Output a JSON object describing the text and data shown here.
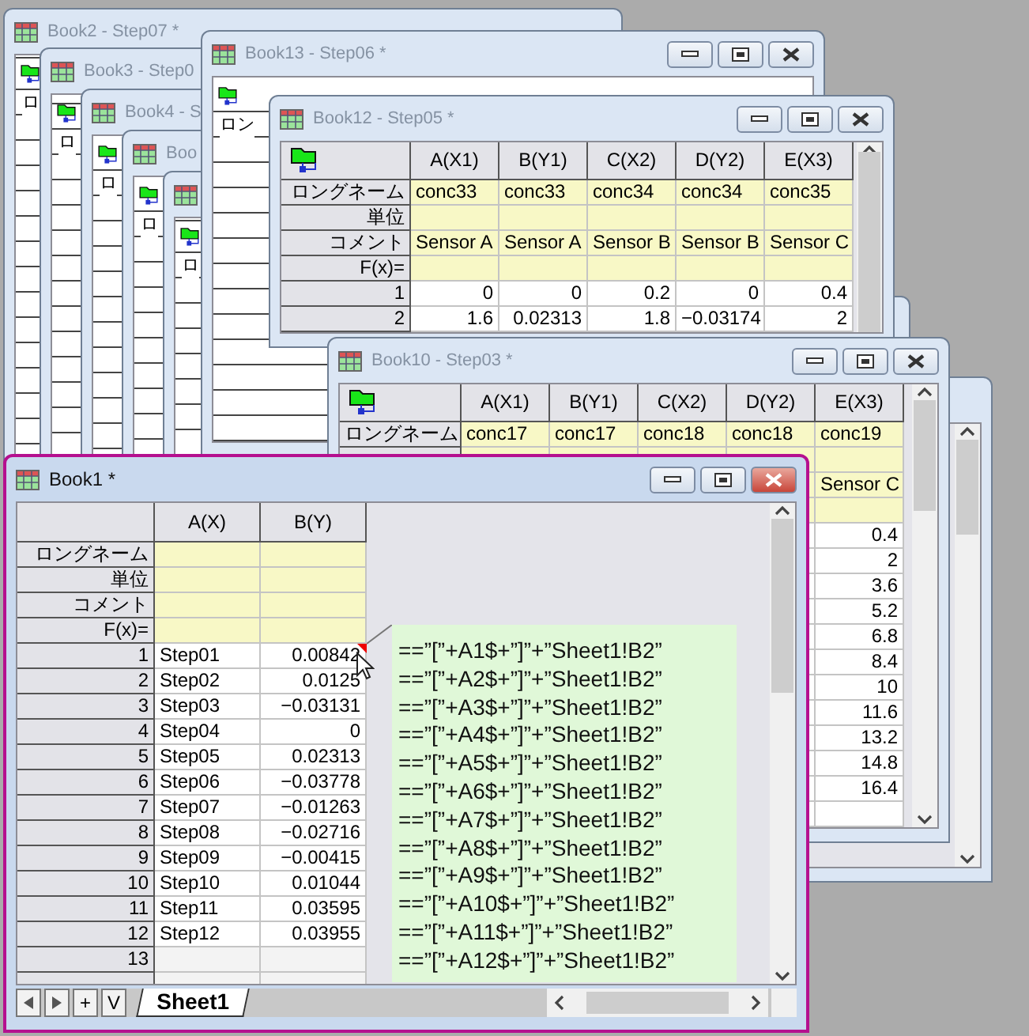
{
  "windows": [
    {
      "kind": "stub",
      "title": "Book2 - Step07 *",
      "row_label": "ロ"
    },
    {
      "kind": "stub",
      "title": "Book3 - Step0",
      "row_label": "ロ"
    },
    {
      "kind": "stub",
      "title": "Book4 - S",
      "row_label": "ロ"
    },
    {
      "kind": "stub",
      "title": "Boo",
      "row_label": "ロ"
    },
    {
      "kind": "stub",
      "row_label": "ロ"
    },
    {
      "kind": "stub",
      "title": "Book13 - Step06 *",
      "row_label": "ロン"
    },
    {
      "kind": "frame"
    },
    {
      "kind": "sheet",
      "title": "Book12 - Step05 *",
      "columns": [
        "A(X1)",
        "B(Y1)",
        "C(X2)",
        "D(Y2)",
        "E(X3)"
      ],
      "meta_rows": [
        {
          "label": "ロングネーム",
          "values": [
            "conc33",
            "conc33",
            "conc34",
            "conc34",
            "conc35"
          ]
        },
        {
          "label": "単位"
        },
        {
          "label": "コメント",
          "values": [
            "Sensor A",
            "Sensor A",
            "Sensor B",
            "Sensor B",
            "Sensor C"
          ]
        },
        {
          "label": "F(x)="
        }
      ],
      "rows": [
        {
          "index": "1",
          "cells": [
            "0",
            "0",
            "0.2",
            "0",
            "0.4"
          ]
        },
        {
          "index": "2",
          "cells": [
            "1.6",
            "0.02313",
            "1.8",
            "−0.03174",
            "2"
          ]
        }
      ]
    },
    {
      "kind": "frame"
    },
    {
      "kind": "partial_sheet",
      "title": "Book10 - Step03 *",
      "columns": [
        "A(X1)",
        "B(Y1)",
        "C(X2)",
        "D(Y2)",
        "E(X3)"
      ],
      "long_name_label": "ロングネーム",
      "long_names": [
        "conc17",
        "conc17",
        "conc18",
        "conc18",
        "conc19"
      ],
      "last_column": {
        "comment": "Sensor C",
        "values": [
          "0.4",
          "2",
          "3.6",
          "5.2",
          "6.8",
          "8.4",
          "10",
          "11.6",
          "13.2",
          "14.8",
          "16.4"
        ]
      }
    }
  ],
  "book1": {
    "title": "Book1 *",
    "columns": [
      "A(X)",
      "B(Y)"
    ],
    "meta_labels": [
      "ロングネーム",
      "単位",
      "コメント",
      "F(x)="
    ],
    "rows": [
      {
        "index": "1",
        "cells": [
          "Step01",
          "0.00842"
        ]
      },
      {
        "index": "2",
        "cells": [
          "Step02",
          "0.0125"
        ]
      },
      {
        "index": "3",
        "cells": [
          "Step03",
          "−0.03131"
        ]
      },
      {
        "index": "4",
        "cells": [
          "Step04",
          "0"
        ]
      },
      {
        "index": "5",
        "cells": [
          "Step05",
          "0.02313"
        ]
      },
      {
        "index": "6",
        "cells": [
          "Step06",
          "−0.03778"
        ]
      },
      {
        "index": "7",
        "cells": [
          "Step07",
          "−0.01263"
        ]
      },
      {
        "index": "8",
        "cells": [
          "Step08",
          "−0.02716"
        ]
      },
      {
        "index": "9",
        "cells": [
          "Step09",
          "−0.00415"
        ]
      },
      {
        "index": "10",
        "cells": [
          "Step10",
          "0.01044"
        ]
      },
      {
        "index": "11",
        "cells": [
          "Step11",
          "0.03595"
        ]
      },
      {
        "index": "12",
        "cells": [
          "Step12",
          "0.03955"
        ]
      }
    ],
    "empty_row_index": "13",
    "note_lines": [
      "==”[”+A1$+”]”+”Sheet1!B2”",
      "==”[”+A2$+”]”+”Sheet1!B2”",
      "==”[”+A3$+”]”+”Sheet1!B2”",
      "==”[”+A4$+”]”+”Sheet1!B2”",
      "==”[”+A5$+”]”+”Sheet1!B2”",
      "==”[”+A6$+”]”+”Sheet1!B2”",
      "==”[”+A7$+”]”+”Sheet1!B2”",
      "==”[”+A8$+”]”+”Sheet1!B2”",
      "==”[”+A9$+”]”+”Sheet1!B2”",
      "==”[”+A10$+”]”+”Sheet1!B2”",
      "==”[”+A11$+”]”+”Sheet1!B2”",
      "==”[”+A12$+”]”+”Sheet1!B2”"
    ],
    "nav_labels": [
      "+",
      "V"
    ],
    "sheet_tab": "Sheet1"
  }
}
